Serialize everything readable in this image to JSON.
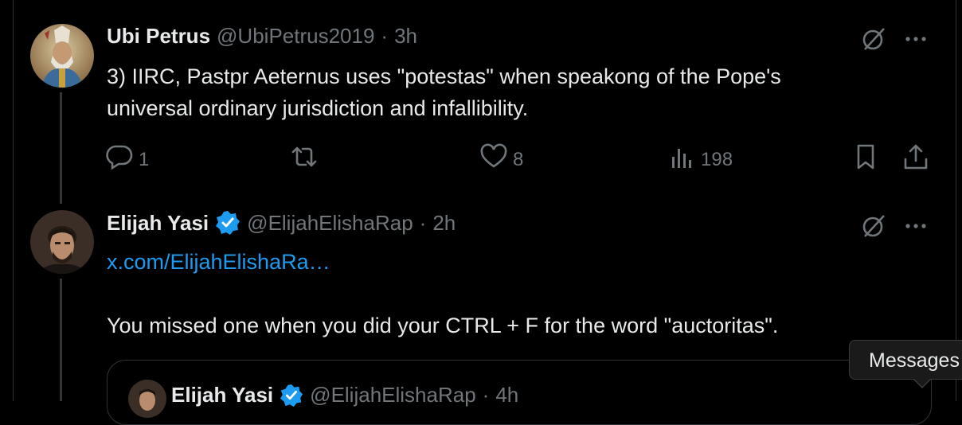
{
  "tweets": [
    {
      "name": "Ubi Petrus",
      "handle": "@UbiPetrus2019",
      "dot": "·",
      "time": "3h",
      "text_line1": "3) IIRC, Pastpr Aeternus uses \"potestas\" when speakong of the Pope's",
      "text_line2": "universal ordinary jurisdiction and infallibility.",
      "replies": "1",
      "likes": "8",
      "views": "198"
    },
    {
      "name": "Elijah Yasi",
      "handle": "@ElijahElishaRap",
      "dot": "·",
      "time": "2h",
      "link": "x.com/ElijahElishaRa…",
      "text": "You missed one when you did your CTRL + F for the word \"auctoritas\"."
    }
  ],
  "quote": {
    "name": "Elijah Yasi",
    "handle": "@ElijahElishaRap",
    "dot": "·",
    "time": "4h"
  },
  "tooltip": {
    "label": "Messages"
  },
  "colors": {
    "accent": "#1d9bf0",
    "muted": "#71767b",
    "text": "#e7e9ea",
    "background": "#000000"
  },
  "icons": [
    "grok-icon",
    "more-icon",
    "reply-icon",
    "repost-icon",
    "like-icon",
    "views-icon",
    "bookmark-icon",
    "share-icon",
    "verified-badge-icon"
  ]
}
